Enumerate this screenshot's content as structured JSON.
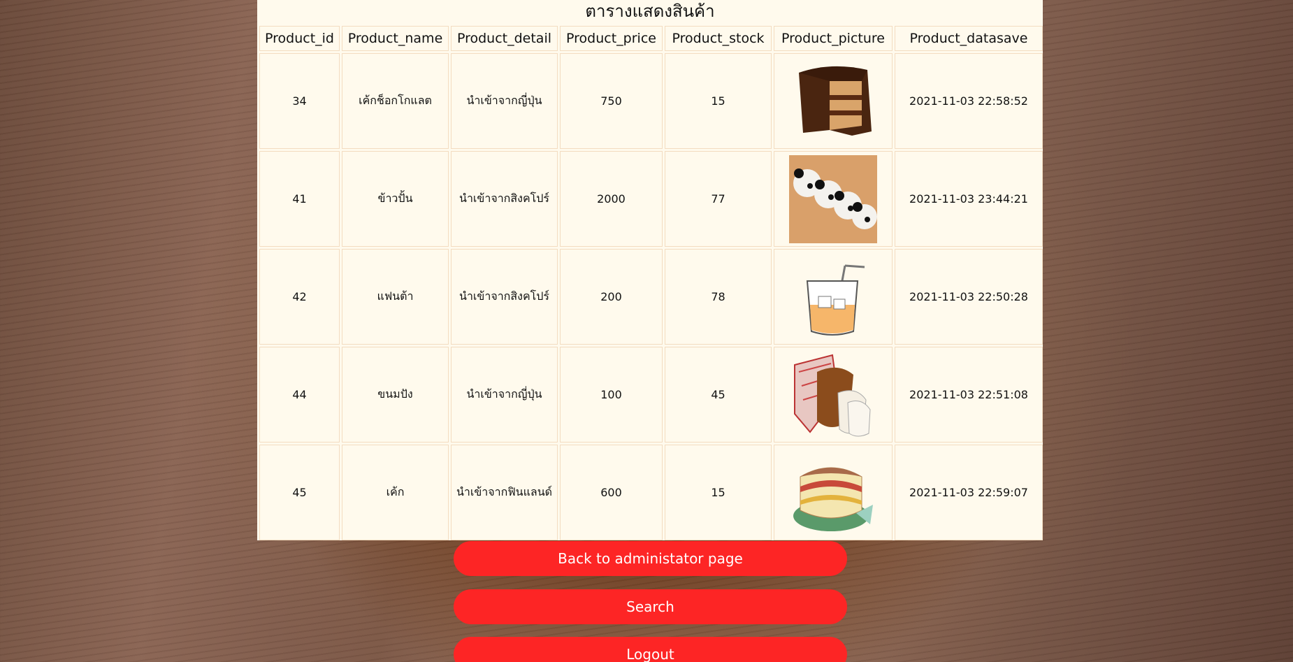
{
  "page": {
    "title": "ตารางแสดงสินค้า"
  },
  "table": {
    "headers": [
      "Product_id",
      "Product_name",
      "Product_detail",
      "Product_price",
      "Product_stock",
      "Product_picture",
      "Product_datasave"
    ],
    "rows": [
      {
        "id": "34",
        "name": "เค้กช็อกโกแลต",
        "detail": "นำเข้าจากญี่ปุ่น",
        "price": "750",
        "stock": "15",
        "picture": "chocolate-cake-image",
        "datasave": "2021-11-03 22:58:52"
      },
      {
        "id": "41",
        "name": "ข้าวปั้น",
        "detail": "นำเข้าจากสิงคโปร์",
        "price": "2000",
        "stock": "77",
        "picture": "panda-rice-balls-image",
        "datasave": "2021-11-03 23:44:21"
      },
      {
        "id": "42",
        "name": "แฟนต้า",
        "detail": "นำเข้าจากสิงคโปร์",
        "price": "200",
        "stock": "78",
        "picture": "drink-glass-image",
        "datasave": "2021-11-03 22:50:28"
      },
      {
        "id": "44",
        "name": "ขนมปัง",
        "detail": "นำเข้าจากญี่ปุ่น",
        "price": "100",
        "stock": "45",
        "picture": "bread-loaf-image",
        "datasave": "2021-11-03 22:51:08"
      },
      {
        "id": "45",
        "name": "เค้ก",
        "detail": "นำเข้าจากฟินแลนด์",
        "price": "600",
        "stock": "15",
        "picture": "layer-cake-image",
        "datasave": "2021-11-03 22:59:07"
      }
    ]
  },
  "buttons": {
    "back": "Back to administator page",
    "search": "Search",
    "logout": "Logout"
  },
  "colors": {
    "panel": "#fffaed",
    "button": "#fd2525",
    "cell_border": "#f3dcc0"
  }
}
